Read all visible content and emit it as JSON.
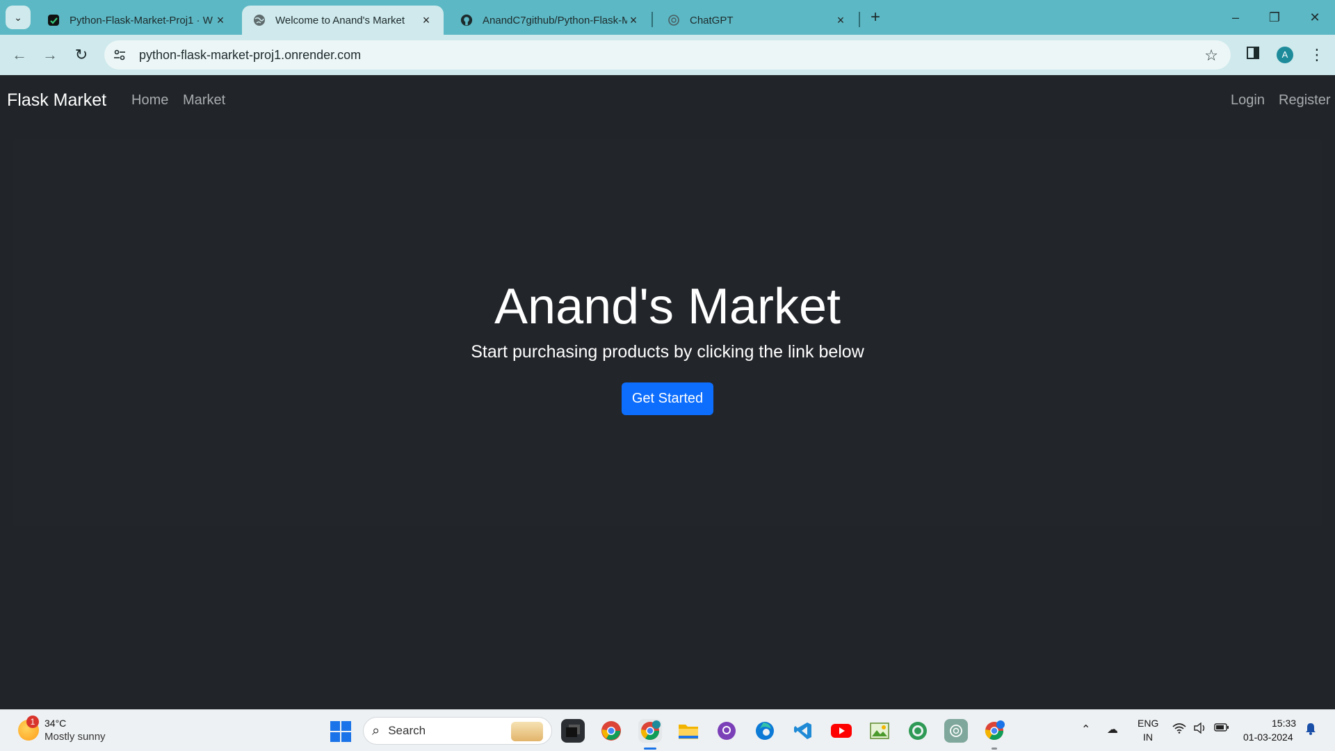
{
  "browser": {
    "tabs": [
      {
        "title": "Python-Flask-Market-Proj1 · W",
        "icon": "render-icon",
        "active": false
      },
      {
        "title": "Welcome to Anand's Market",
        "icon": "globe-icon",
        "active": true
      },
      {
        "title": "AnandC7github/Python-Flask-M",
        "icon": "github-icon",
        "active": false
      },
      {
        "title": "ChatGPT",
        "icon": "chatgpt-icon",
        "active": false
      }
    ],
    "url": "python-flask-market-proj1.onrender.com",
    "profile_initial": "A"
  },
  "navbar": {
    "brand": "Flask Market",
    "links": [
      "Home",
      "Market"
    ],
    "right_links": [
      "Login",
      "Register"
    ]
  },
  "hero": {
    "title": "Anand's Market",
    "subtitle": "Start purchasing products by clicking the link below",
    "button": "Get Started"
  },
  "taskbar": {
    "weather": {
      "temp": "34°C",
      "desc": "Mostly sunny",
      "badge": "1"
    },
    "search_label": "Search",
    "language": {
      "line1": "ENG",
      "line2": "IN"
    },
    "clock": {
      "time": "15:33",
      "date": "01-03-2024"
    }
  },
  "colors": {
    "tabstrip": "#5cb8c4",
    "toolbar": "#cfe9ec",
    "page_bg": "#212529",
    "primary_button": "#0d6efd"
  }
}
